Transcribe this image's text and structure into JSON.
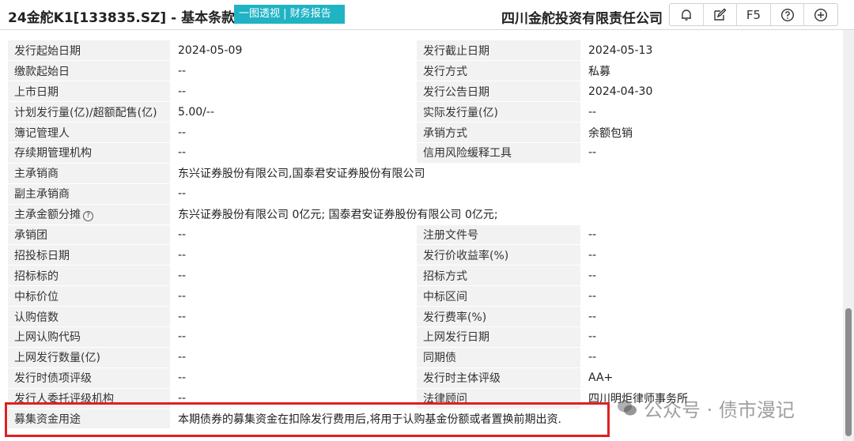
{
  "header": {
    "title": "24金舵K1[133835.SZ] - 基本条款",
    "tab_link": "一图透视 | 财务报告",
    "company": "四川金舵投资有限责任公司",
    "toolbar": {
      "bell_icon": "bell-icon",
      "edit_icon": "edit-icon",
      "f5_label": "F5",
      "help_icon": "help-icon",
      "add_icon": "plus-circle-icon"
    }
  },
  "rows": [
    {
      "l1": "发行起始日期",
      "v1": "2024-05-09",
      "l2": "发行截止日期",
      "v2": "2024-05-13"
    },
    {
      "l1": "缴款起始日",
      "v1": "--",
      "l2": "发行方式",
      "v2": "私募"
    },
    {
      "l1": "上市日期",
      "v1": "--",
      "l2": "发行公告日期",
      "v2": "2024-04-30"
    },
    {
      "l1": "计划发行量(亿)/超额配售(亿)",
      "v1": "5.00/--",
      "l2": "实际发行量(亿)",
      "v2": "--"
    },
    {
      "l1": "簿记管理人",
      "v1": "--",
      "l2": "承销方式",
      "v2": "余额包销"
    },
    {
      "l1": "存续期管理机构",
      "v1": "--",
      "l2": "信用风险缓释工具",
      "v2": "--"
    },
    {
      "l1": "主承销商",
      "v1": "东兴证券股份有限公司,国泰君安证券股份有限公司"
    },
    {
      "l1": "副主承销商",
      "v1": "--"
    },
    {
      "l1": "主承金额分摊",
      "v1": "东兴证券股份有限公司 0亿元; 国泰君安证券股份有限公司 0亿元;",
      "help": "?"
    },
    {
      "l1": "承销团",
      "v1": "--",
      "l2": "注册文件号",
      "v2": "--"
    },
    {
      "l1": "招投标日期",
      "v1": "--",
      "l2": "发行价收益率(%)",
      "v2": "--"
    },
    {
      "l1": "招标标的",
      "v1": "--",
      "l2": "招标方式",
      "v2": "--"
    },
    {
      "l1": "中标价位",
      "v1": "--",
      "l2": "中标区间",
      "v2": "--"
    },
    {
      "l1": "认购倍数",
      "v1": "--",
      "l2": "发行费率(%)",
      "v2": "--"
    },
    {
      "l1": "上网认购代码",
      "v1": "--",
      "l2": "上网发行日期",
      "v2": "--"
    },
    {
      "l1": "上网发行数量(亿)",
      "v1": "--",
      "l2": "同期债",
      "v2": "--"
    },
    {
      "l1": "发行时债项评级",
      "v1": "--",
      "l2": "发行时主体评级",
      "v2": "AA+"
    },
    {
      "l1": "发行人委托评级机构",
      "v1": "--",
      "l2": "法律顾问",
      "v2": "四川明炬律师事务所"
    },
    {
      "l1": "募集资金用途",
      "v1": "本期债券的募集资金在扣除发行费用后,将用于认购基金份额或者置换前期出资."
    }
  ],
  "watermark": "公众号 · 债市漫记",
  "colors": {
    "accent": "#1fb3c4",
    "highlight": "#e02020",
    "label_bg": "#f2f2f2"
  }
}
